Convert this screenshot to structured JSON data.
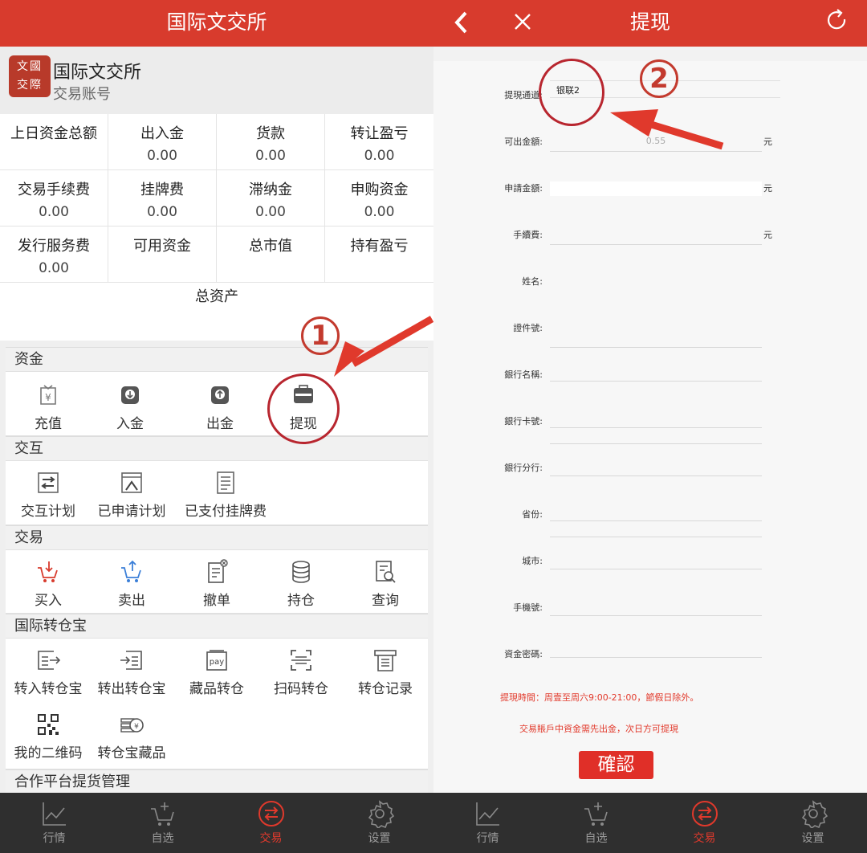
{
  "left": {
    "title": "国际文交所",
    "account": {
      "name": "国际文交所",
      "sub": "交易账号",
      "logo_text": "文國 交際"
    },
    "stats": [
      {
        "label": "上日资金总额",
        "value": ""
      },
      {
        "label": "出入金",
        "value": "0.00"
      },
      {
        "label": "货款",
        "value": "0.00"
      },
      {
        "label": "转让盈亏",
        "value": "0.00"
      },
      {
        "label": "交易手续费",
        "value": "0.00"
      },
      {
        "label": "挂牌费",
        "value": "0.00"
      },
      {
        "label": "滞纳金",
        "value": "0.00"
      },
      {
        "label": "申购资金",
        "value": "0.00"
      },
      {
        "label": "发行服务费",
        "value": "0.00"
      },
      {
        "label": "可用资金",
        "value": ""
      },
      {
        "label": "总市值",
        "value": ""
      },
      {
        "label": "持有盈亏",
        "value": ""
      }
    ],
    "total_label": "总资产",
    "sections": {
      "funds": {
        "title": "资金",
        "items": [
          "充值",
          "入金",
          "出金",
          "提现"
        ]
      },
      "interact": {
        "title": "交互",
        "items": [
          "交互计划",
          "已申请计划",
          "已支付挂牌费"
        ]
      },
      "trade": {
        "title": "交易",
        "items": [
          "买入",
          "卖出",
          "撤单",
          "持仓",
          "查询"
        ]
      },
      "transfer": {
        "title": "国际转仓宝",
        "items": [
          "转入转仓宝",
          "转出转仓宝",
          "藏品转仓",
          "扫码转仓",
          "转仓记录",
          "我的二维码",
          "转仓宝藏品"
        ]
      },
      "platform": {
        "title": "合作平台提货管理"
      }
    },
    "annotation_number": "1"
  },
  "tabs": [
    "行情",
    "自选",
    "交易",
    "设置"
  ],
  "right": {
    "title": "提现",
    "form": {
      "channel_label": "提現通道:",
      "channel_value": "银联2",
      "available_label": "可出金額:",
      "available_value": "0.55",
      "unit": "元",
      "apply_label": "申請金額:",
      "fee_label": "手續費:",
      "name_label": "姓名:",
      "id_label": "證件號:",
      "bank_label": "銀行名稱:",
      "card_label": "銀行卡號:",
      "branch_label": "銀行分行:",
      "province_label": "省份:",
      "city_label": "城市:",
      "phone_label": "手機號:",
      "password_label": "資金密碼:",
      "note1": "提現時間：周壹至周六9:00-21:00，節假日除外。",
      "note2": "交易賬戶中資金需先出金，次日方可提現",
      "confirm": "確認"
    },
    "annotation_number": "2"
  },
  "colors": {
    "brand_red": "#d83b2d",
    "tab_bg": "#2f2f2f",
    "annotation": "#c33a2e"
  }
}
